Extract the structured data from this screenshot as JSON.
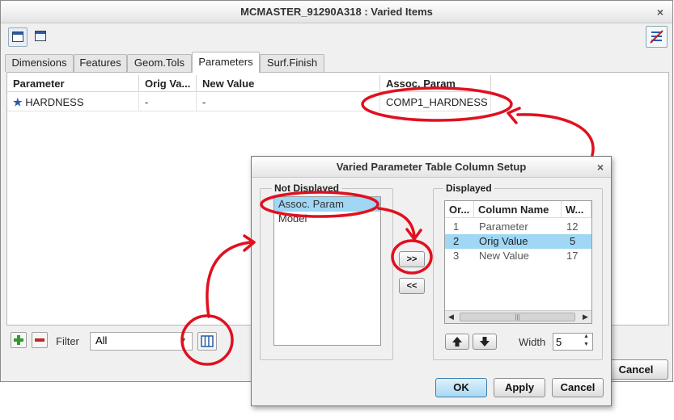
{
  "main": {
    "title": "MCMASTER_91290A318 : Varied Items",
    "close_glyph": "×",
    "tabs": [
      {
        "label": "Dimensions"
      },
      {
        "label": "Features"
      },
      {
        "label": "Geom.Tols"
      },
      {
        "label": "Parameters",
        "active": true
      },
      {
        "label": "Surf.Finish"
      }
    ],
    "table": {
      "headers": [
        "Parameter",
        "Orig Va...",
        "New Value",
        "Assoc. Param"
      ],
      "rows": [
        {
          "parameter": "HARDNESS",
          "orig_value": "-",
          "new_value": "-",
          "assoc_param": "COMP1_HARDNESS"
        }
      ]
    },
    "filter_label": "Filter",
    "filter_value": "All",
    "cancel_label": "Cancel"
  },
  "dialog": {
    "title": "Varied Parameter Table Column Setup",
    "close_glyph": "×",
    "not_displayed_title": "Not Displayed",
    "not_displayed_items": [
      "Assoc. Param",
      "Model"
    ],
    "move_right_label": ">>",
    "move_left_label": "<<",
    "displayed_title": "Displayed",
    "displayed_headers": [
      "Or...",
      "Column Name",
      "W..."
    ],
    "displayed_rows": [
      {
        "order": "1",
        "name": "Parameter",
        "width": "12"
      },
      {
        "order": "2",
        "name": "Orig Value",
        "width": "5"
      },
      {
        "order": "3",
        "name": "New Value",
        "width": "17"
      }
    ],
    "scroll_thumb_glyph": "|||",
    "width_label": "Width",
    "width_value": "5",
    "ok_label": "OK",
    "apply_label": "Apply",
    "cancel_label": "Cancel"
  },
  "colors": {
    "annotation": "#e01020",
    "selection": "#9fd7f5"
  }
}
